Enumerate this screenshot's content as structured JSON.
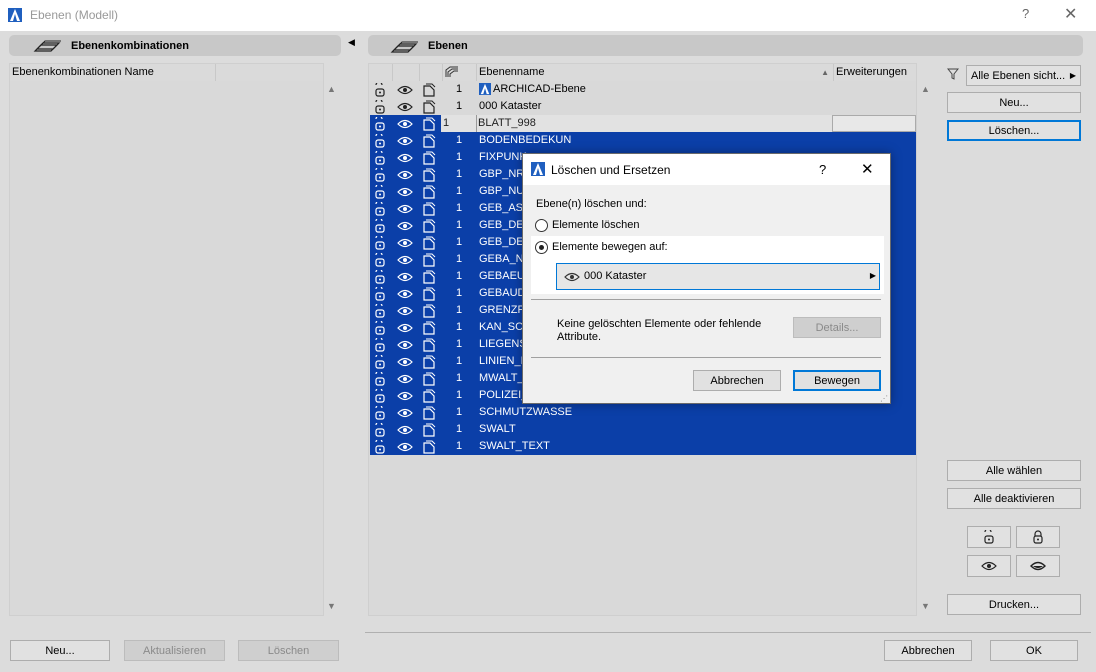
{
  "window": {
    "title": "Ebenen (Modell)",
    "help": "?",
    "close": "✕"
  },
  "left_panel": {
    "header": "Ebenenkombinationen",
    "column_header": "Ebenenkombinationen Name",
    "buttons": {
      "new": "Neu...",
      "update": "Aktualisieren",
      "delete": "Löschen"
    }
  },
  "right_panel": {
    "header": "Ebenen",
    "columns": {
      "name": "Ebenenname",
      "extensions": "Erweiterungen"
    },
    "layers": [
      {
        "num": "1",
        "name": "ARCHICAD-Ebene",
        "selected": false,
        "has_logo": true
      },
      {
        "num": "1",
        "name": "000 Kataster",
        "selected": false
      },
      {
        "num": "1",
        "name": "BLATT_998",
        "selected": true,
        "editing": true
      },
      {
        "num": "1",
        "name": "BODENBEDEKUN",
        "selected": true
      },
      {
        "num": "1",
        "name": "FIXPUNK",
        "selected": true
      },
      {
        "num": "1",
        "name": "GBP_NR",
        "selected": true
      },
      {
        "num": "1",
        "name": "GBP_NU",
        "selected": true
      },
      {
        "num": "1",
        "name": "GEB_ASS",
        "selected": true
      },
      {
        "num": "1",
        "name": "GEB_DE",
        "selected": true
      },
      {
        "num": "1",
        "name": "GEB_DE",
        "selected": true
      },
      {
        "num": "1",
        "name": "GEBA_N",
        "selected": true
      },
      {
        "num": "1",
        "name": "GEBAEU",
        "selected": true
      },
      {
        "num": "1",
        "name": "GEBAUD",
        "selected": true
      },
      {
        "num": "1",
        "name": "GRENZP",
        "selected": true
      },
      {
        "num": "1",
        "name": "KAN_SC",
        "selected": true
      },
      {
        "num": "1",
        "name": "LIEGENS",
        "selected": true
      },
      {
        "num": "1",
        "name": "LINIEN_E",
        "selected": true
      },
      {
        "num": "1",
        "name": "MWALT_",
        "selected": true
      },
      {
        "num": "1",
        "name": "POLIZEI_",
        "selected": true
      },
      {
        "num": "1",
        "name": "SCHMUTZWASSE",
        "selected": true
      },
      {
        "num": "1",
        "name": "SWALT",
        "selected": true
      },
      {
        "num": "1",
        "name": "SWALT_TEXT",
        "selected": true
      }
    ]
  },
  "sidebar": {
    "filter": "Alle Ebenen sicht...",
    "new": "Neu...",
    "delete": "Löschen...",
    "select_all": "Alle wählen",
    "deselect_all": "Alle deaktivieren",
    "print": "Drucken..."
  },
  "footer": {
    "cancel": "Abbrechen",
    "ok": "OK"
  },
  "dialog": {
    "title": "Löschen und Ersetzen",
    "help": "?",
    "close": "✕",
    "prompt": "Ebene(n) löschen und:",
    "option_delete": "Elemente löschen",
    "option_move": "Elemente bewegen auf:",
    "selected_option": "move",
    "target_layer": "000 Kataster",
    "info_line1": "Keine gelöschten Elemente oder fehlende",
    "info_line2": "Attribute.",
    "details": "Details...",
    "cancel": "Abbrechen",
    "confirm": "Bewegen"
  },
  "colors": {
    "selection": "#0b3fa8",
    "focus": "#0078d7",
    "archicad_blue": "#1f5fbf"
  }
}
